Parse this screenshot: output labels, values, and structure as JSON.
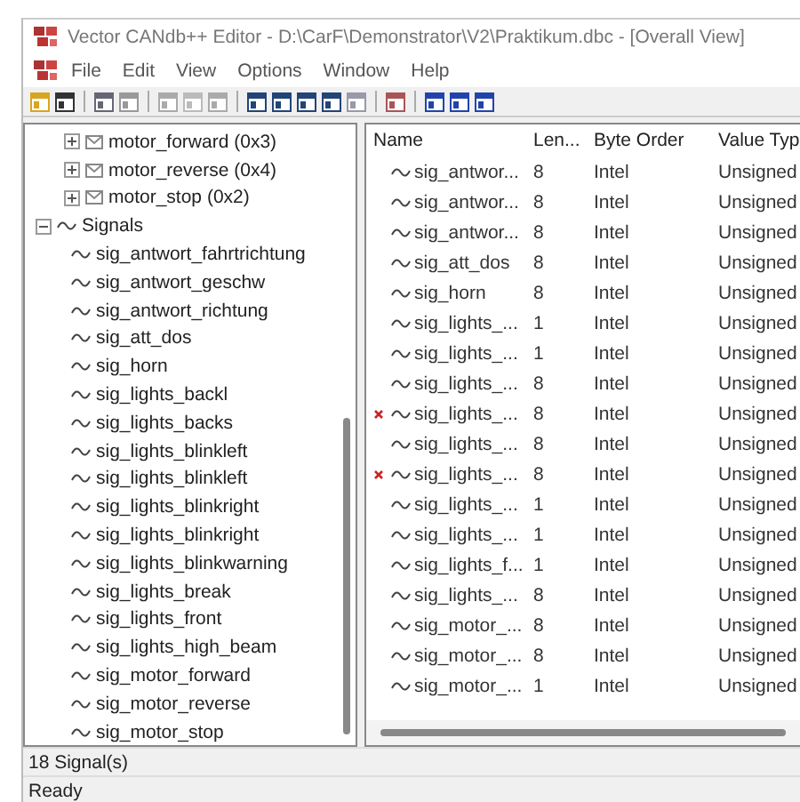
{
  "window": {
    "title": "Vector CANdb++ Editor - D:\\CarF\\Demonstrator\\V2\\Praktikum.dbc - [Overall View]"
  },
  "menu": [
    "File",
    "Edit",
    "View",
    "Options",
    "Window",
    "Help"
  ],
  "tree": [
    {
      "label": "motor_forward (0x3)",
      "kind": "message",
      "expanded": false
    },
    {
      "label": "motor_reverse (0x4)",
      "kind": "message",
      "expanded": false
    },
    {
      "label": "motor_stop (0x2)",
      "kind": "message",
      "expanded": false
    },
    {
      "label": "Signals",
      "kind": "folder",
      "expanded": true,
      "children": [
        {
          "label": "sig_antwort_fahrtrichtung",
          "kind": "signal"
        },
        {
          "label": "sig_antwort_geschw",
          "kind": "signal"
        },
        {
          "label": "sig_antwort_richtung",
          "kind": "signal"
        },
        {
          "label": "sig_att_dos",
          "kind": "signal"
        },
        {
          "label": "sig_horn",
          "kind": "signal"
        },
        {
          "label": "sig_lights_backl",
          "kind": "signal"
        },
        {
          "label": "sig_lights_backs",
          "kind": "signal"
        },
        {
          "label": "sig_lights_blinkleft",
          "kind": "signal"
        },
        {
          "label": "sig_lights_blinkleft",
          "kind": "signal"
        },
        {
          "label": "sig_lights_blinkright",
          "kind": "signal"
        },
        {
          "label": "sig_lights_blinkright",
          "kind": "signal"
        },
        {
          "label": "sig_lights_blinkwarning",
          "kind": "signal"
        },
        {
          "label": "sig_lights_break",
          "kind": "signal"
        },
        {
          "label": "sig_lights_front",
          "kind": "signal"
        },
        {
          "label": "sig_lights_high_beam",
          "kind": "signal"
        },
        {
          "label": "sig_motor_forward",
          "kind": "signal"
        },
        {
          "label": "sig_motor_reverse",
          "kind": "signal"
        },
        {
          "label": "sig_motor_stop",
          "kind": "signal"
        }
      ]
    }
  ],
  "table": {
    "columns": [
      "Name",
      "Len...",
      "Byte Order",
      "Value Typ"
    ],
    "rows": [
      {
        "name": "sig_antwor...",
        "length": "8",
        "byte_order": "Intel",
        "value_type": "Unsigned",
        "flagged": false
      },
      {
        "name": "sig_antwor...",
        "length": "8",
        "byte_order": "Intel",
        "value_type": "Unsigned",
        "flagged": false
      },
      {
        "name": "sig_antwor...",
        "length": "8",
        "byte_order": "Intel",
        "value_type": "Unsigned",
        "flagged": false
      },
      {
        "name": "sig_att_dos",
        "length": "8",
        "byte_order": "Intel",
        "value_type": "Unsigned",
        "flagged": false
      },
      {
        "name": "sig_horn",
        "length": "8",
        "byte_order": "Intel",
        "value_type": "Unsigned",
        "flagged": false
      },
      {
        "name": "sig_lights_...",
        "length": "1",
        "byte_order": "Intel",
        "value_type": "Unsigned",
        "flagged": false
      },
      {
        "name": "sig_lights_...",
        "length": "1",
        "byte_order": "Intel",
        "value_type": "Unsigned",
        "flagged": false
      },
      {
        "name": "sig_lights_...",
        "length": "8",
        "byte_order": "Intel",
        "value_type": "Unsigned",
        "flagged": false
      },
      {
        "name": "sig_lights_...",
        "length": "8",
        "byte_order": "Intel",
        "value_type": "Unsigned",
        "flagged": true
      },
      {
        "name": "sig_lights_...",
        "length": "8",
        "byte_order": "Intel",
        "value_type": "Unsigned",
        "flagged": false
      },
      {
        "name": "sig_lights_...",
        "length": "8",
        "byte_order": "Intel",
        "value_type": "Unsigned",
        "flagged": true
      },
      {
        "name": "sig_lights_...",
        "length": "1",
        "byte_order": "Intel",
        "value_type": "Unsigned",
        "flagged": false
      },
      {
        "name": "sig_lights_...",
        "length": "1",
        "byte_order": "Intel",
        "value_type": "Unsigned",
        "flagged": false
      },
      {
        "name": "sig_lights_f...",
        "length": "1",
        "byte_order": "Intel",
        "value_type": "Unsigned",
        "flagged": false
      },
      {
        "name": "sig_lights_...",
        "length": "8",
        "byte_order": "Intel",
        "value_type": "Unsigned",
        "flagged": false
      },
      {
        "name": "sig_motor_...",
        "length": "8",
        "byte_order": "Intel",
        "value_type": "Unsigned",
        "flagged": false
      },
      {
        "name": "sig_motor_...",
        "length": "8",
        "byte_order": "Intel",
        "value_type": "Unsigned",
        "flagged": false
      },
      {
        "name": "sig_motor_...",
        "length": "1",
        "byte_order": "Intel",
        "value_type": "Unsigned",
        "flagged": false
      }
    ]
  },
  "status_bar": {
    "count": "18 Signal(s)",
    "state": "Ready"
  }
}
